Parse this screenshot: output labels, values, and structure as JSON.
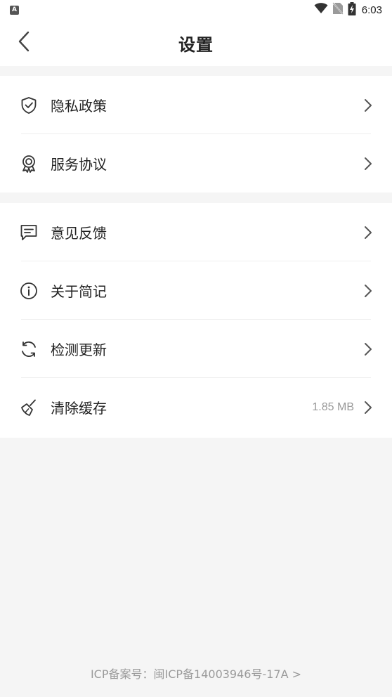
{
  "status_bar": {
    "notification_icon": "app-notification-icon",
    "notification_letter": "A",
    "time": "6:03",
    "icons": [
      "wifi-icon",
      "no-sim-icon",
      "battery-charging-icon"
    ]
  },
  "header": {
    "title": "设置",
    "back_icon": "chevron-left-icon"
  },
  "groups": [
    {
      "items": [
        {
          "label": "隐私政策",
          "icon": "shield-check-icon"
        },
        {
          "label": "服务协议",
          "icon": "award-badge-icon"
        }
      ]
    },
    {
      "items": [
        {
          "label": "意见反馈",
          "icon": "message-square-icon"
        },
        {
          "label": "关于简记",
          "icon": "info-circle-icon"
        },
        {
          "label": "检测更新",
          "icon": "refresh-icon"
        },
        {
          "label": "清除缓存",
          "icon": "broom-icon",
          "value": "1.85 MB"
        }
      ]
    }
  ],
  "footer": {
    "text": "ICP备案号：闽ICP备14003946号-17A >"
  },
  "colors": {
    "background": "#f5f5f5",
    "surface": "#ffffff",
    "text_primary": "#222222",
    "text_secondary": "#999999",
    "icon": "#333333",
    "chevron": "#555555"
  }
}
